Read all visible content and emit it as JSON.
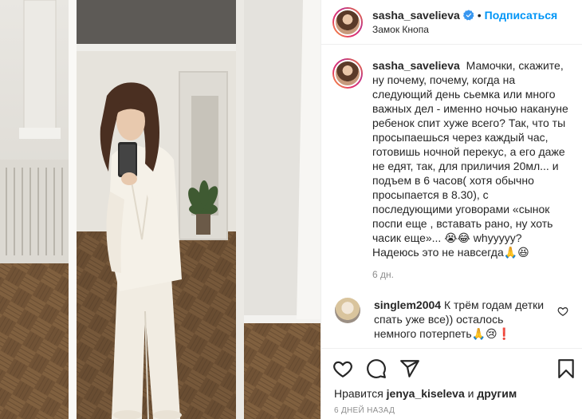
{
  "header": {
    "username": "sasha_savelieva",
    "dot": "•",
    "follow_label": "Подписаться",
    "location": "Замок Кнопа"
  },
  "caption": {
    "username": "sasha_savelieva",
    "text": "Мамочки, скажите, ну почему, почему, когда на следующий день сьемка или много важных дел - именно ночью накануне ребенок спит хуже всего? Так, что ты просыпаешься через каждый час, готовишь ночной перекус, а его даже не едят, так, для приличия 20мл... и подъем в 6 часов( хотя обычно просыпается в 8.30), с последующими уговорами «сынок поспи еще , вставать рано, ну хоть часик еще»... 😭😂 whyyyyy? Надеюсь это не навсегда🙏😆",
    "time": "6 дн."
  },
  "comment": {
    "username": "singlem2004",
    "text": "К трём годам детки спать уже все)) осталось немного потерпеть🙏😢❗"
  },
  "likes": {
    "prefix": "Нравится",
    "user": "jenya_kiseleva",
    "conj": "и",
    "others": "другим"
  },
  "date": "6 ДНЕЙ НАЗАД",
  "icons": {
    "like": "heart-icon",
    "comment": "comment-icon",
    "share": "share-icon",
    "save": "bookmark-icon",
    "verified": "verified-badge-icon"
  },
  "colors": {
    "accent": "#0095f6",
    "verified": "#3897f0",
    "muted": "#8e8e8e",
    "text": "#262626"
  }
}
